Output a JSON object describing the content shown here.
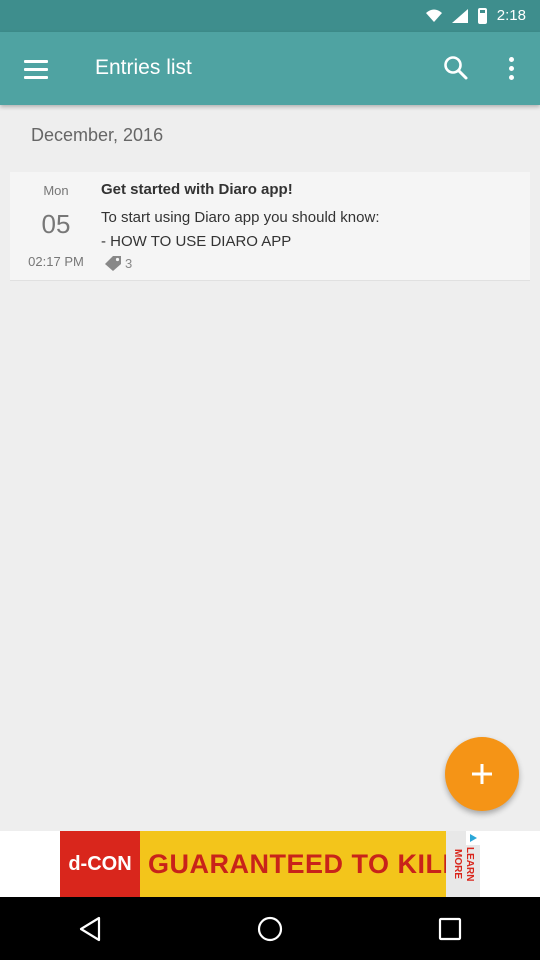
{
  "status_bar": {
    "time": "2:18"
  },
  "app_bar": {
    "title": "Entries list"
  },
  "section": {
    "month": "December, 2016"
  },
  "entries": [
    {
      "day_of_week": "Mon",
      "day": "05",
      "time": "02:17 PM",
      "title": "Get started with Diaro app!",
      "text_line1": "To start using Diaro app you should know:",
      "text_line2": "- HOW TO USE DIARO APP",
      "tag_count": "3"
    }
  ],
  "ad": {
    "brand": "d-CON",
    "headline": "GUARANTEED TO KILL",
    "cta": "LEARN MORE"
  },
  "colors": {
    "status_bar": "#3e8e8d",
    "app_bar": "#4fa3a2",
    "fab": "#f59416",
    "background": "#eeeeee"
  },
  "icons": {
    "menu": "menu-icon",
    "search": "search-icon",
    "more": "more-vert-icon",
    "tag": "tag-icon",
    "add": "plus-icon",
    "back": "back-icon",
    "home": "home-icon",
    "recents": "recents-icon"
  }
}
